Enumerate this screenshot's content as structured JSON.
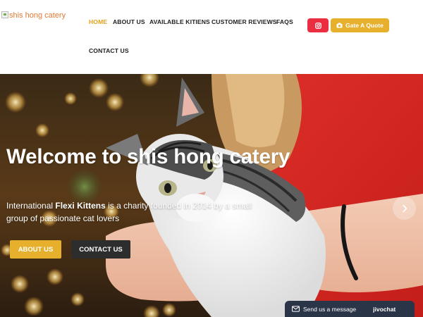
{
  "header": {
    "logo_alt": "shis hong catery",
    "nav": [
      {
        "label": "HOME",
        "active": true
      },
      {
        "label": "ABOUT US",
        "active": false
      },
      {
        "label": "AVAILABLE KITIENS",
        "active": false
      },
      {
        "label": "CUSTOMER REVIEWS",
        "active": false
      },
      {
        "label": "FAQS",
        "active": false
      },
      {
        "label": "CONTACT US",
        "active": false
      }
    ],
    "social_icon": "instagram-icon",
    "quote_button": {
      "label": "Gate A Quote",
      "icon": "camera-icon"
    }
  },
  "hero": {
    "title": "Welcome to shis hong catery",
    "description_prefix": "International ",
    "description_bold": "Flexi Kittens",
    "description_suffix": " is a charity founded in 2014 by a small group of passionate cat lovers",
    "primary_button": "ABOUT US",
    "secondary_button": "CONTACT US",
    "next_icon": "chevron-right-icon"
  },
  "chat": {
    "label": "Send us a message",
    "brand": "jivochat",
    "icon": "mail-icon"
  },
  "colors": {
    "accent": "#e7b02c",
    "nav_active": "#e1a21e",
    "instagram": "#ea2d3f",
    "dark_button": "#2d2d2d",
    "chat": "#2b3548"
  }
}
